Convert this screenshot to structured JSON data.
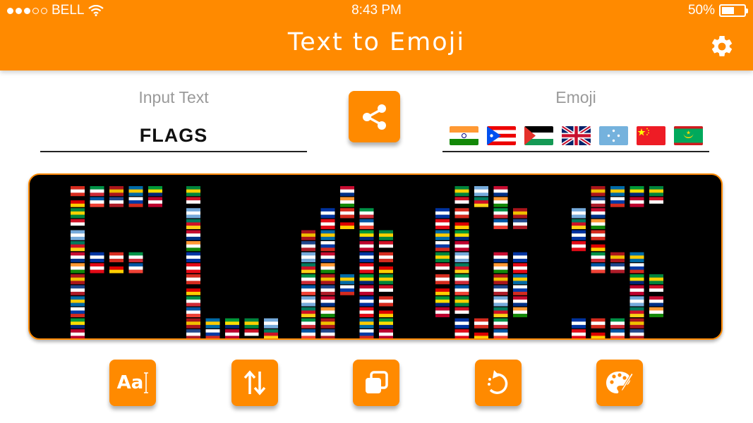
{
  "status_bar": {
    "carrier": "BELL",
    "signal_bars": 3,
    "signal_total": 5,
    "time": "8:43 PM",
    "battery": "50%",
    "battery_level": 0.5
  },
  "header": {
    "title": "Text to Emoji",
    "settings_icon": "gear-icon"
  },
  "input": {
    "label": "Input Text",
    "value": "FLAGS"
  },
  "share": {
    "icon": "share-icon"
  },
  "emoji": {
    "label": "Emoji",
    "flags": [
      "India",
      "Puerto Rico",
      "Palestine",
      "United Kingdom",
      "Micronesia",
      "China",
      "Mauritania"
    ]
  },
  "preview": {
    "text": "FLAGS",
    "style": "flag emoji mosaic"
  },
  "toolbar": {
    "buttons": [
      {
        "name": "font-button",
        "icon": "font-icon",
        "glyph": "Aa"
      },
      {
        "name": "swap-button",
        "icon": "swap-vertical-icon"
      },
      {
        "name": "copy-button",
        "icon": "copy-icon"
      },
      {
        "name": "reset-button",
        "icon": "rotate-icon"
      },
      {
        "name": "palette-button",
        "icon": "palette-icon"
      }
    ]
  },
  "colors": {
    "accent": "#FF8A00",
    "preview_bg": "#000000",
    "label": "#9a9a9a"
  }
}
